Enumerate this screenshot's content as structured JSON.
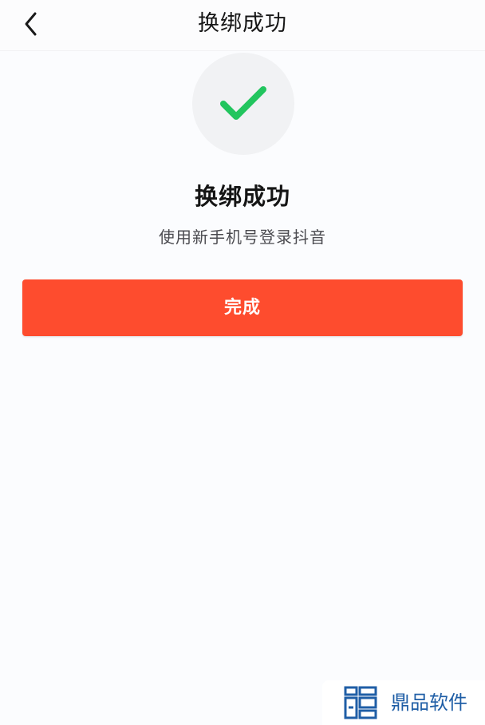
{
  "header": {
    "back_icon": "chevron-left-icon",
    "title": "换绑成功"
  },
  "result": {
    "icon": "checkmark-icon",
    "icon_color": "#22c55e",
    "title": "换绑成功",
    "subtitle": "使用新手机号登录抖音"
  },
  "actions": {
    "done_label": "完成",
    "done_color": "#fe4c2e"
  },
  "watermark": {
    "logo_icon": "brand-logo-icon",
    "text": "鼎品软件",
    "color": "#1f5ea6"
  }
}
